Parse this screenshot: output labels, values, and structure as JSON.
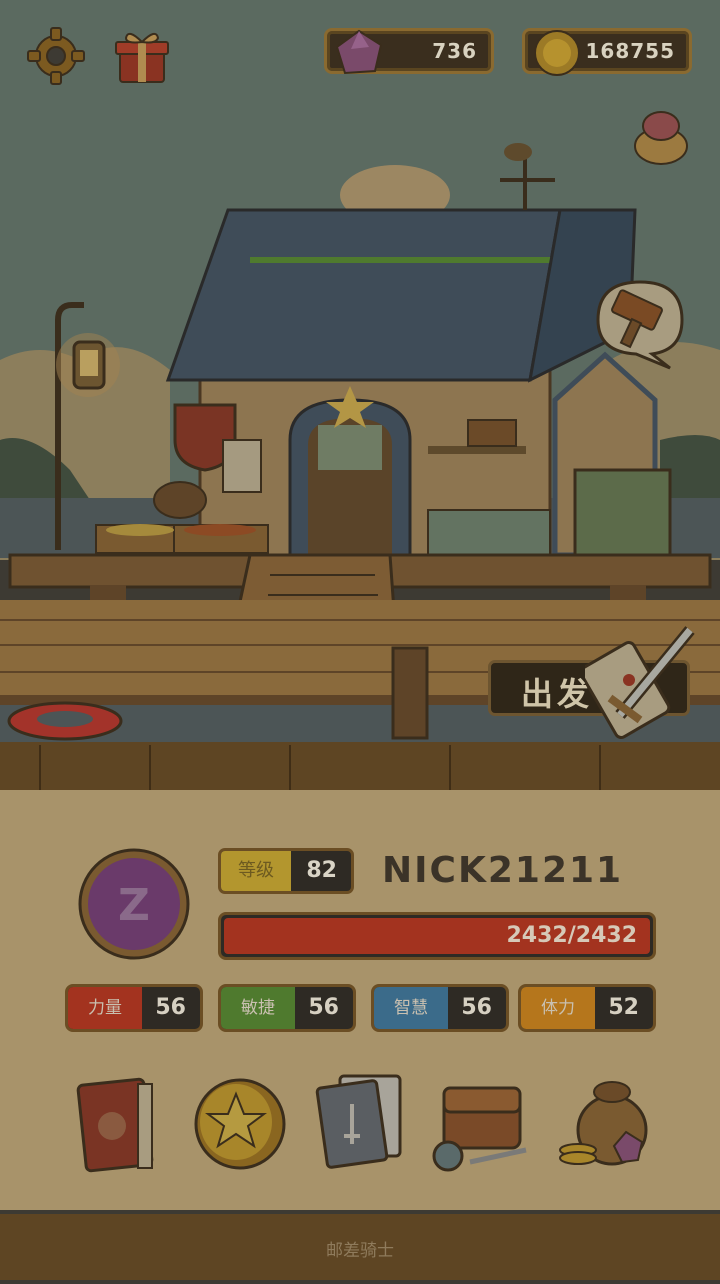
{
  "hud": {
    "gems": "736",
    "coins": "168755"
  },
  "main": {
    "depart_label": "出发"
  },
  "player": {
    "name": "NICK21211",
    "level_label": "等级",
    "level": "82",
    "hp_text": "2432/2432",
    "hp_fraction": 1.0,
    "emblem_letter": "Z"
  },
  "stats": [
    {
      "label": "力量",
      "value": "56",
      "color": "#a3331f"
    },
    {
      "label": "敏捷",
      "value": "56",
      "color": "#4f7a2e"
    },
    {
      "label": "智慧",
      "value": "56",
      "color": "#3b6b8a"
    },
    {
      "label": "体力",
      "value": "52",
      "color": "#b5761c"
    }
  ],
  "menu_icons": [
    "book-icon",
    "star-coin-icon",
    "cards-icon",
    "bag-icon",
    "treasure-icon"
  ],
  "footer": {
    "label": "邮差骑士"
  }
}
